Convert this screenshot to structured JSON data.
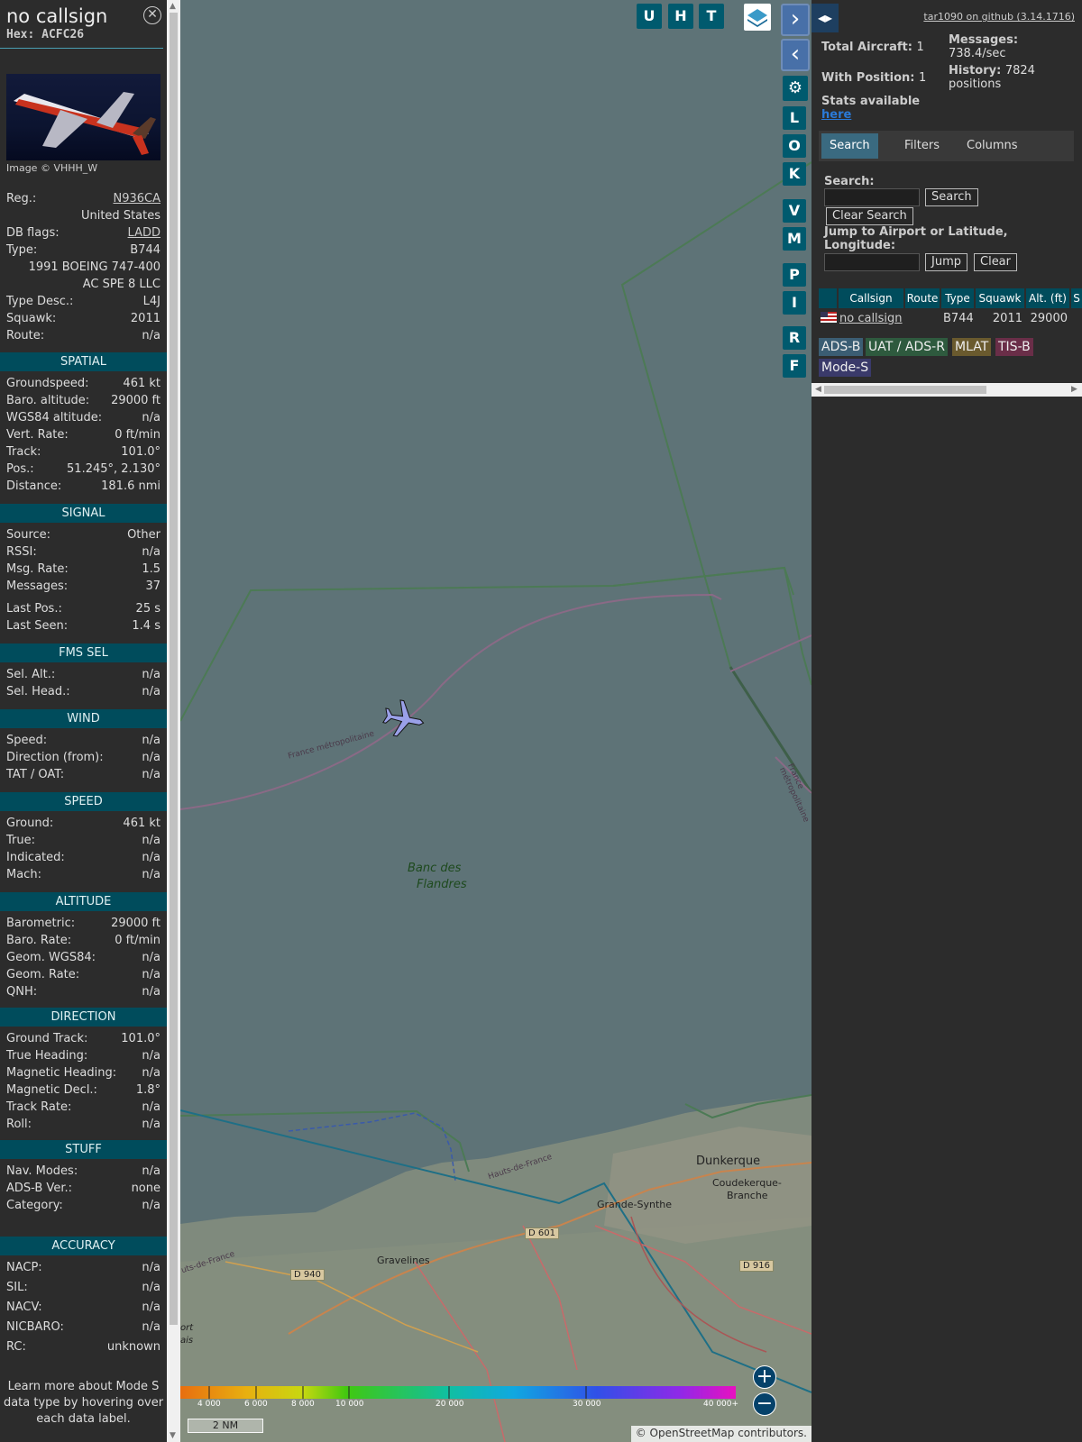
{
  "selected": {
    "callsign": "no callsign",
    "hex_label": "Hex: ACFC26",
    "close_label": "✕",
    "image_credit": "Image © VHHH_W",
    "rows": [
      {
        "k": "Reg.:",
        "v": "N936CA"
      },
      {
        "k": "",
        "v": "United States"
      },
      {
        "k": "DB flags:",
        "v": "LADD"
      },
      {
        "k": "Type:",
        "v": "B744"
      },
      {
        "k": "",
        "v": "1991 BOEING 747-400"
      },
      {
        "k": "",
        "v": "AC SPE 8 LLC"
      },
      {
        "k": "Type Desc.:",
        "v": "L4J"
      },
      {
        "k": "Squawk:",
        "v": "2011"
      },
      {
        "k": "Route:",
        "v": "n/a"
      }
    ],
    "sections": {
      "spatial": "SPATIAL",
      "signal": "SIGNAL",
      "fms": "FMS SEL",
      "wind": "WIND",
      "speed": "SPEED",
      "altitude": "ALTITUDE",
      "direction": "DIRECTION",
      "stuff": "STUFF",
      "accuracy": "ACCURACY"
    },
    "spatial": [
      {
        "k": "Groundspeed:",
        "v": "461 kt"
      },
      {
        "k": "Baro. altitude:",
        "v": "29000 ft"
      },
      {
        "k": "WGS84 altitude:",
        "v": "n/a"
      },
      {
        "k": "Vert. Rate:",
        "v": "0 ft/min"
      },
      {
        "k": "Track:",
        "v": "101.0°"
      },
      {
        "k": "Pos.:",
        "v": "51.245°, 2.130°"
      },
      {
        "k": "Distance:",
        "v": "181.6 nmi"
      }
    ],
    "signal": [
      {
        "k": "Source:",
        "v": "Other"
      },
      {
        "k": "RSSI:",
        "v": "n/a"
      },
      {
        "k": "Msg. Rate:",
        "v": "1.5"
      },
      {
        "k": "Messages:",
        "v": "37"
      },
      {
        "k": "Last Pos.:",
        "v": "25 s"
      },
      {
        "k": "Last Seen:",
        "v": "1.4 s"
      }
    ],
    "fms": [
      {
        "k": "Sel. Alt.:",
        "v": "n/a"
      },
      {
        "k": "Sel. Head.:",
        "v": "n/a"
      }
    ],
    "wind": [
      {
        "k": "Speed:",
        "v": "n/a"
      },
      {
        "k": "Direction (from):",
        "v": "n/a"
      },
      {
        "k": "TAT / OAT:",
        "v": "n/a"
      }
    ],
    "speed": [
      {
        "k": "Ground:",
        "v": "461 kt"
      },
      {
        "k": "True:",
        "v": "n/a"
      },
      {
        "k": "Indicated:",
        "v": "n/a"
      },
      {
        "k": "Mach:",
        "v": "n/a"
      }
    ],
    "altitude": [
      {
        "k": "Barometric:",
        "v": "29000 ft"
      },
      {
        "k": "Baro. Rate:",
        "v": "0 ft/min"
      },
      {
        "k": "Geom. WGS84:",
        "v": "n/a"
      },
      {
        "k": "Geom. Rate:",
        "v": "n/a"
      },
      {
        "k": "QNH:",
        "v": "n/a"
      }
    ],
    "direction": [
      {
        "k": "Ground Track:",
        "v": "101.0°"
      },
      {
        "k": "True Heading:",
        "v": "n/a"
      },
      {
        "k": "Magnetic Heading:",
        "v": "n/a"
      },
      {
        "k": "Magnetic Decl.:",
        "v": "1.8°"
      },
      {
        "k": "Track Rate:",
        "v": "n/a"
      },
      {
        "k": "Roll:",
        "v": "n/a"
      }
    ],
    "stuff": [
      {
        "k": "Nav. Modes:",
        "v": "n/a"
      },
      {
        "k": "ADS-B Ver.:",
        "v": "none"
      },
      {
        "k": "Category:",
        "v": "n/a"
      }
    ],
    "accuracy": [
      {
        "k": "NACP:",
        "v": "n/a"
      },
      {
        "k": "SIL:",
        "v": "n/a"
      },
      {
        "k": "NACV:",
        "v": "n/a"
      },
      {
        "k": "NICBARO:",
        "v": "n/a"
      },
      {
        "k": "RC:",
        "v": "unknown"
      }
    ],
    "footer": "Learn more about Mode S data type by hovering over each data label."
  },
  "map": {
    "buttons": [
      "U",
      "H",
      "T"
    ],
    "side_buttons": [
      "L",
      "O",
      "K",
      "V",
      "M",
      "P",
      "I",
      "R",
      "F"
    ],
    "labels": {
      "france1": "France métropolitaine",
      "france2": "France métropolitaine",
      "banc1": "Banc des",
      "banc2": "Flandres",
      "dunkerque": "Dunkerque",
      "coude1": "Coudekerque-",
      "coude2": "Branche",
      "grande": "Grande-Synthe",
      "grave": "Gravelines",
      "hdf": "Hauts-de-France",
      "hdf2": "uts-de-France",
      "d601": "D 601",
      "d940": "D 940",
      "d916": "D 916",
      "port": "ort",
      "cais": "ais"
    },
    "altitude_scale": [
      "4 000",
      "6 000",
      "8 000",
      "10 000",
      "20 000",
      "30 000",
      "40 000+"
    ],
    "scale_bar": "2 NM",
    "attribution": "© OpenStreetMap contributors."
  },
  "panel": {
    "github": "tar1090 on github (3.14.1716)",
    "total_aircraft_label": "Total Aircraft:",
    "total_aircraft": "1",
    "with_position_label": "With Position:",
    "with_position": "1",
    "messages_label": "Messages:",
    "messages": "738.4/sec",
    "history_label": "History:",
    "history": "7824 positions",
    "stats_label": "Stats available",
    "stats_link": "here",
    "tabs": [
      "Search",
      "Filters",
      "Columns"
    ],
    "search_label": "Search:",
    "search_button": "Search",
    "clear_search": "Clear Search",
    "jump_label": "Jump to Airport or Latitude, Longitude:",
    "jump_button": "Jump",
    "clear_button": "Clear",
    "columns": [
      "Callsign",
      "Route",
      "Type",
      "Squawk",
      "Alt. (ft)",
      "S"
    ],
    "row": {
      "callsign": "no callsign",
      "route": "",
      "type": "B744",
      "squawk": "2011",
      "alt": "29000"
    },
    "sources": [
      "ADS-B",
      "UAT / ADS-R",
      "MLAT",
      "TIS-B",
      "Mode-S"
    ],
    "source_colors": [
      "#3b5d73",
      "#2e5a3e",
      "#6a5a2e",
      "#6a2e48",
      "#3a3a6a"
    ]
  }
}
